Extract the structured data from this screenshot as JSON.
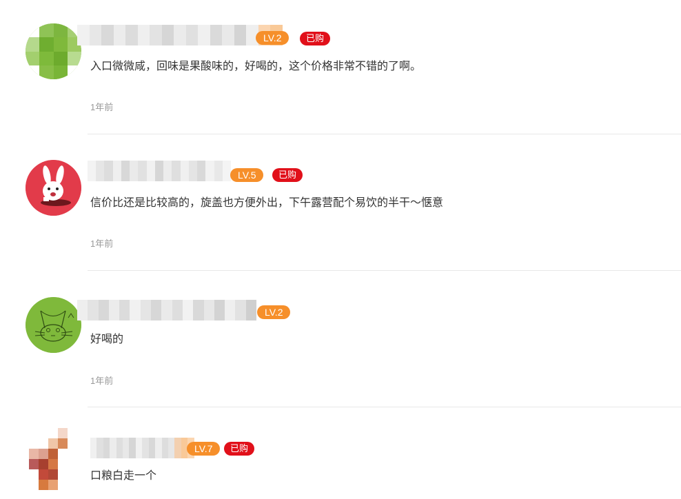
{
  "comments": [
    {
      "level": "LV.2",
      "buy_badge": "已购",
      "text": "入口微微咸，回味是果酸味的，好喝的，这个价格非常不错的了啊。",
      "time": "1年前"
    },
    {
      "level": "LV.5",
      "buy_badge": "已购",
      "text": "信价比还是比较高的，旋盖也方便外出，下午露营配个易饮的半干～惬意",
      "time": "1年前"
    },
    {
      "level": "LV.2",
      "buy_badge": "",
      "text": "好喝的",
      "time": "1年前"
    },
    {
      "level": "LV.7",
      "buy_badge": "已购",
      "text": "口粮白走一个",
      "time": ""
    }
  ],
  "colors": {
    "level_badge": "#f68f2a",
    "buy_badge": "#e1101a",
    "avatar_green": "#7fb93b",
    "avatar_red": "#e23b4a"
  }
}
